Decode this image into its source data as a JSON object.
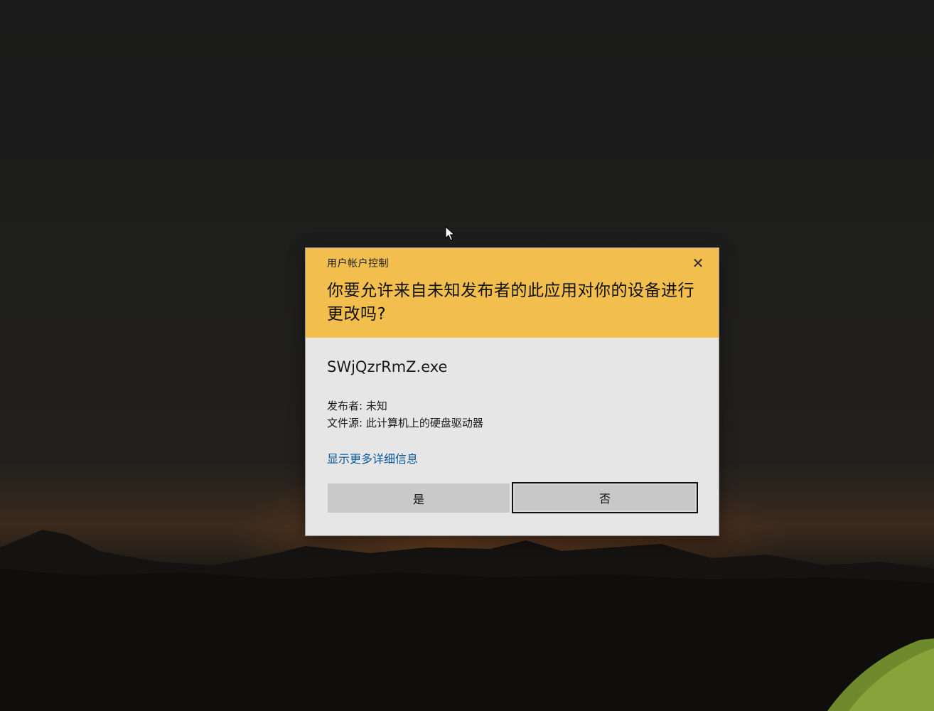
{
  "dialog": {
    "caption": "用户帐户控制",
    "close_glyph": "✕",
    "question": "你要允许来自未知发布者的此应用对你的设备进行更改吗?",
    "app_name": "SWjQzrRmZ.exe",
    "publisher_line": "发布者: 未知",
    "source_line": "文件源: 此计算机上的硬盘驱动器",
    "more_details_link": "显示更多详细信息",
    "yes_label": "是",
    "no_label": "否"
  },
  "colors": {
    "header_accent": "#f2bf4e",
    "body_bg": "#e6e6e6",
    "link": "#0a5a9c"
  },
  "icons": {
    "cursor": "arrow-cursor-icon",
    "close": "close-icon"
  }
}
